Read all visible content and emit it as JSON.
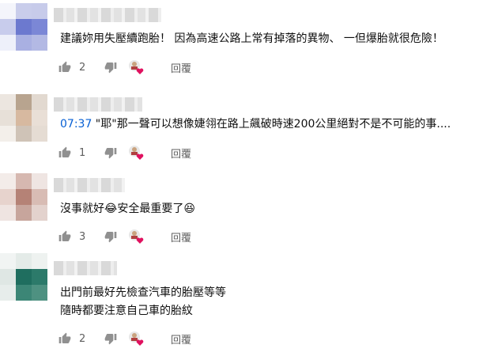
{
  "colors": {
    "link": "#065fd4",
    "meta": "#606060",
    "heart": "#e0115f",
    "text": "#0f0f0f"
  },
  "comments": [
    {
      "text": "建議妳用失壓續跑胎！ 因為高速公路上常有掉落的異物、 一但爆胎就很危險！",
      "likes": "2",
      "reply": "回覆",
      "heart_icon": "creator-heart-icon",
      "like_icon": "thumb-up-icon",
      "dislike_icon": "thumb-down-icon"
    },
    {
      "timestamp": "07:37",
      "text": " \"耶\"那一聲可以想像婕翎在路上飆破時速200公里絕對不是不可能的事....",
      "likes": "1",
      "reply": "回覆"
    },
    {
      "text": "沒事就好😂安全最重要了😆",
      "likes": "3",
      "reply": "回覆"
    },
    {
      "lines": [
        "出門前最好先檢查汽車的胎壓等等",
        "隨時都要注意自己車的胎紋"
      ],
      "likes": "2",
      "reply": "回覆"
    }
  ]
}
